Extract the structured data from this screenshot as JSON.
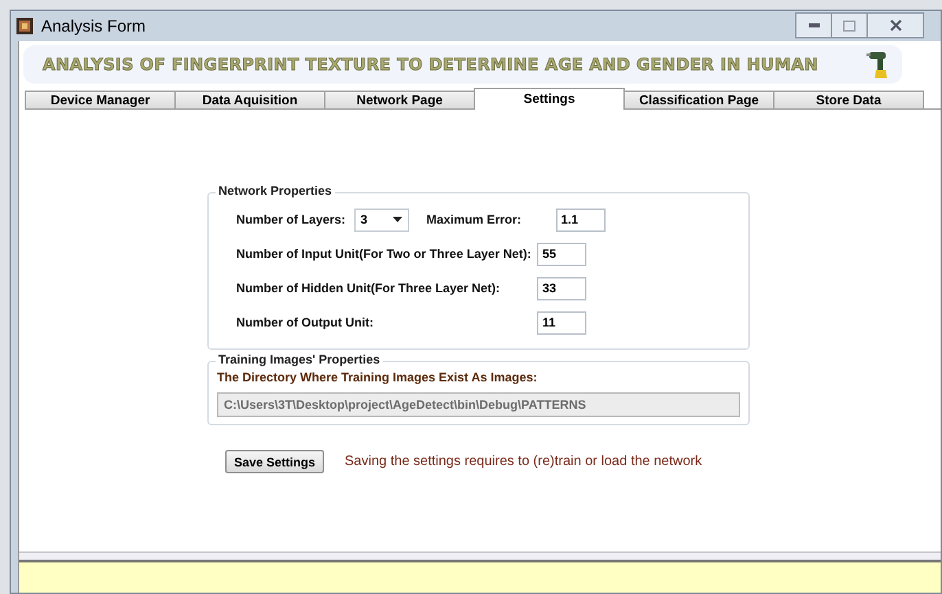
{
  "window": {
    "title": "Analysis Form"
  },
  "banner": {
    "title": "ANALYSIS OF FINGERPRINT TEXTURE TO DETERMINE AGE AND GENDER IN HUMAN"
  },
  "tabs": [
    {
      "label": "Device Manager",
      "selected": false
    },
    {
      "label": "Data Aquisition",
      "selected": false
    },
    {
      "label": "Network Page",
      "selected": false
    },
    {
      "label": "Settings",
      "selected": true
    },
    {
      "label": "Classification Page",
      "selected": false
    },
    {
      "label": "Store Data",
      "selected": false
    }
  ],
  "network_properties": {
    "title": "Network Properties",
    "layers_label": "Number of Layers:",
    "layers_value": "3",
    "max_error_label": "Maximum Error:",
    "max_error_value": "1.1",
    "fields": [
      {
        "label": "Number of Input Unit(For Two or Three Layer Net):",
        "value": "55"
      },
      {
        "label": "Number of Hidden Unit(For Three Layer Net):",
        "value": "33"
      },
      {
        "label": "Number of Output Unit:",
        "value": "11"
      }
    ]
  },
  "training_properties": {
    "title": "Training Images' Properties",
    "label": "The Directory Where Training Images Exist As Images:",
    "path": "C:\\Users\\3T\\Desktop\\project\\AgeDetect\\bin\\Debug\\PATTERNS",
    "disabled": true
  },
  "save_button": "Save Settings",
  "message": "Saving the settings requires to (re)train or load the network"
}
